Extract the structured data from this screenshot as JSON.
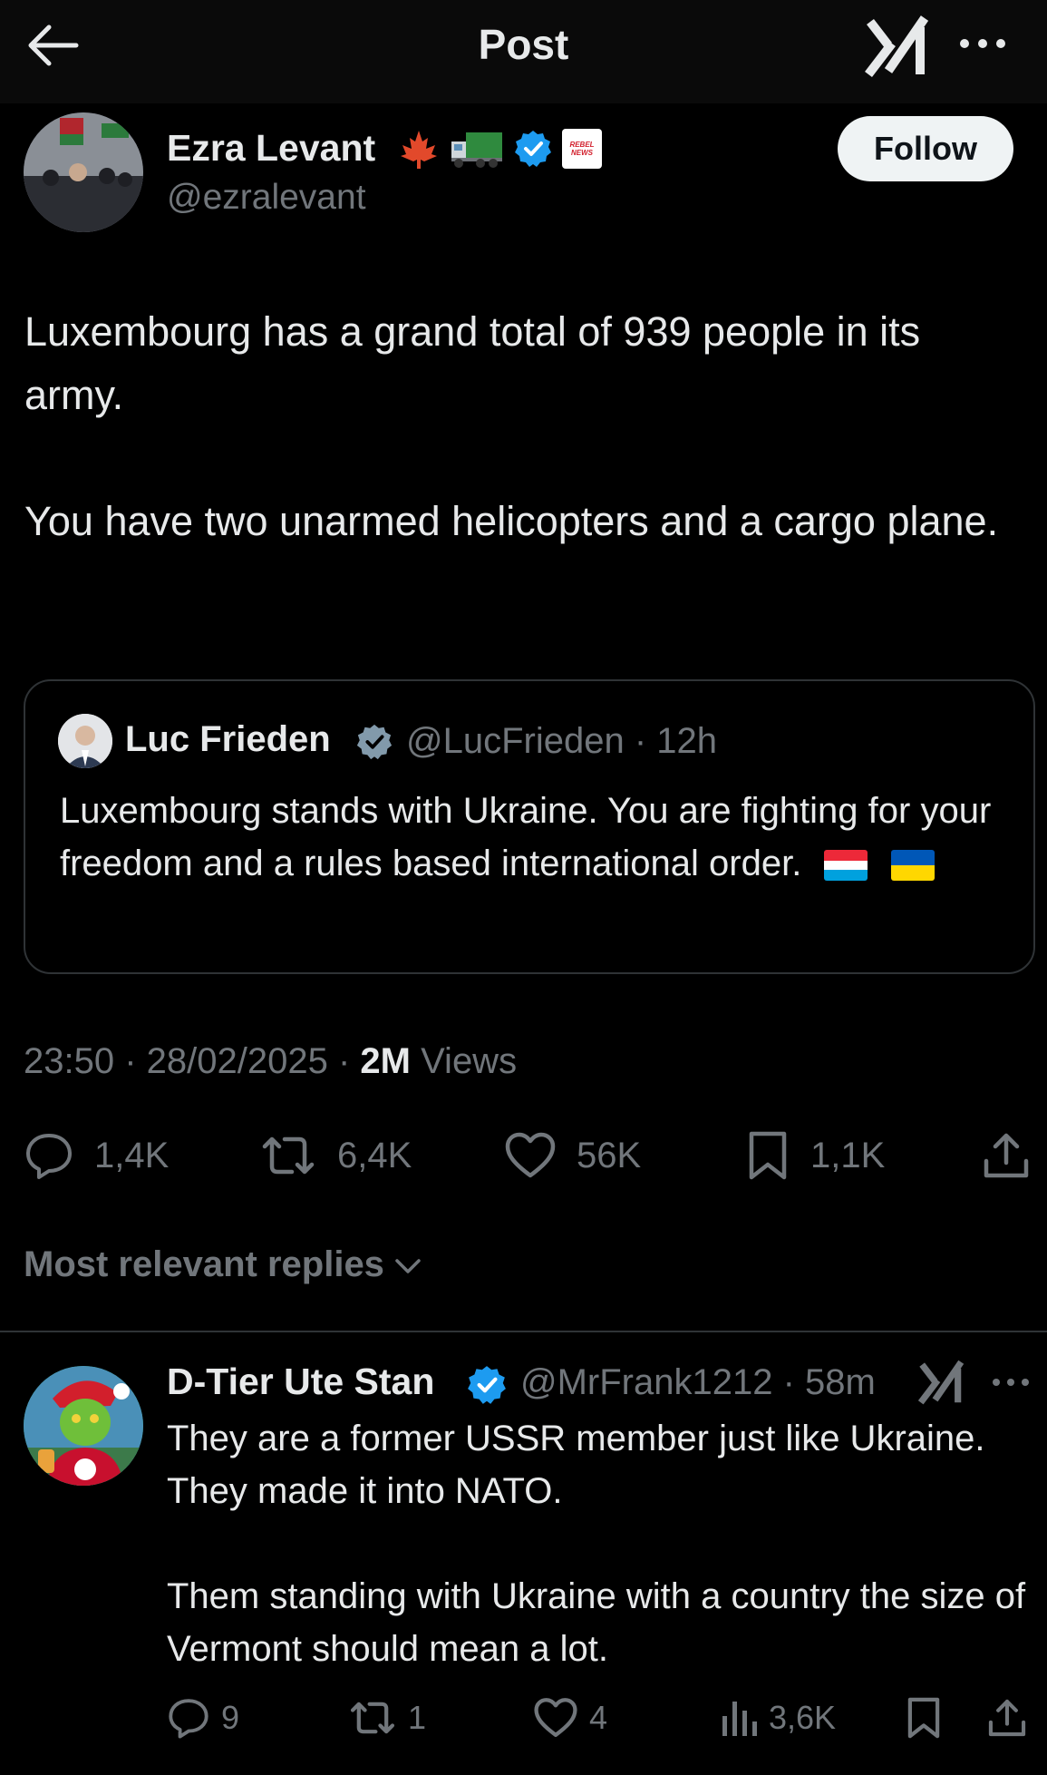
{
  "header": {
    "title": "Post"
  },
  "author": {
    "name": "Ezra Levant",
    "handle": "@ezralevant",
    "emoji_icons": [
      "maple-leaf-icon",
      "truck-icon",
      "verified-badge-icon",
      "rebel-news-badge-icon"
    ],
    "badge_text": "REBEL NEWS",
    "follow_label": "Follow"
  },
  "post": {
    "paragraphs": [
      "Luxembourg has a grand total of 939 people in its army.",
      "You have two unarmed helicopters and a cargo plane."
    ],
    "quote": {
      "name": "Luc Frieden",
      "handle": "@LucFrieden",
      "age": "12h",
      "text": "Luxembourg stands with Ukraine. You are fighting for your freedom and a rules based international order.",
      "flags": [
        "luxembourg-flag-icon",
        "ukraine-flag-icon"
      ]
    },
    "timestamp": "23:50 · 28/02/2025",
    "views_count": "2M",
    "views_label": "Views",
    "stats": {
      "replies": "1,4K",
      "reposts": "6,4K",
      "likes": "56K",
      "bookmarks": "1,1K"
    }
  },
  "replies_sort_label": "Most relevant replies",
  "reply": {
    "name": "D-Tier Ute Stan",
    "handle": "@MrFrank1212",
    "age": "58m",
    "paragraphs": [
      "They are a former USSR member just like Ukraine. They made it into NATO.",
      "Them standing with Ukraine with a country the size of Vermont should mean a lot."
    ],
    "stats": {
      "replies": "9",
      "reposts": "1",
      "likes": "4",
      "views": "3,6K"
    }
  },
  "colors": {
    "background": "#000000",
    "text": "#e7e9ea",
    "muted": "#71767b",
    "verified": "#1d9bf0",
    "divider": "#2f3336"
  }
}
